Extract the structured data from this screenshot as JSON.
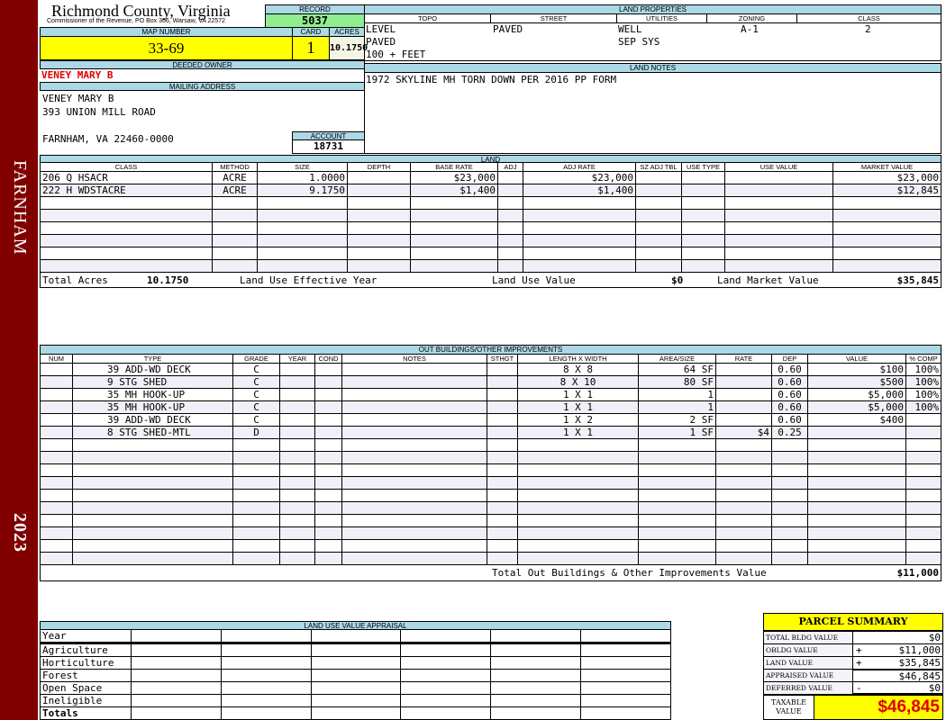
{
  "sidebar": {
    "locality": "FARNHAM",
    "year": "2023"
  },
  "header": {
    "county": "Richmond County, Virginia",
    "subtitle": "Commissioner of the Revenue, PO Box 366, Warsaw, VA 22572",
    "record_label": "RECORD",
    "record": "5037",
    "map_number_label": "MAP NUMBER",
    "map_number": "33-69",
    "card_label": "CARD",
    "card": "1",
    "acres_label": "ACRES",
    "acres": "10.1750"
  },
  "owner": {
    "deeded_owner_label": "DEEDED OWNER",
    "deeded_owner": "VENEY MARY B",
    "mailing_label": "MAILING ADDRESS",
    "lines": [
      "VENEY MARY B",
      "393 UNION MILL ROAD",
      "",
      "FARNHAM, VA 22460-0000"
    ],
    "account_label": "ACCOUNT",
    "account": "18731"
  },
  "land_properties": {
    "title": "LAND PROPERTIES",
    "headers": [
      "TOPO",
      "STREET",
      "UTILITIES",
      "ZONING",
      "CLASS"
    ],
    "topo": [
      "LEVEL",
      "PAVED",
      "100 + FEET"
    ],
    "street": "PAVED",
    "utilities": [
      "WELL",
      "SEP SYS"
    ],
    "zoning": "A-1",
    "class": "2"
  },
  "land_notes": {
    "title": "LAND NOTES",
    "text": "1972 SKYLINE MH TORN DOWN PER 2016 PP FORM"
  },
  "land": {
    "title": "LAND",
    "headers": [
      "CLASS",
      "METHOD",
      "SIZE",
      "DEPTH",
      "BASE RATE",
      "ADJ",
      "ADJ RATE",
      "SZ ADJ TBL",
      "USE TYPE",
      "USE VALUE",
      "MARKET VALUE"
    ],
    "rows": [
      [
        "206 Q HSACR",
        "ACRE",
        "1.0000",
        "",
        "$23,000",
        "",
        "$23,000",
        "",
        "",
        "",
        "$23,000"
      ],
      [
        "222 H WDSTACRE",
        "ACRE",
        "9.1750",
        "",
        "$1,400",
        "",
        "$1,400",
        "",
        "",
        "",
        "$12,845"
      ]
    ],
    "total_acres_label": "Total Acres",
    "total_acres": "10.1750",
    "effective_year_label": "Land Use Effective Year",
    "use_value_label": "Land Use Value",
    "use_value": "$0",
    "market_value_label": "Land Market Value",
    "market_value": "$35,845"
  },
  "outbuildings": {
    "title": "OUT BUILDINGS/OTHER IMPROVEMENTS",
    "headers": [
      "NUM",
      "TYPE",
      "GRADE",
      "YEAR",
      "COND",
      "NOTES",
      "STHGT",
      "LENGTH X WIDTH",
      "AREA/SIZE",
      "RATE",
      "DEP",
      "VALUE",
      "% COMP"
    ],
    "rows": [
      [
        "",
        "39 ADD-WD DECK",
        "C",
        "",
        "",
        "",
        "",
        "8 X 8",
        "64 SF",
        "",
        "0.60",
        "$100",
        "100%"
      ],
      [
        "",
        "9 STG SHED",
        "C",
        "",
        "",
        "",
        "",
        "8 X 10",
        "80 SF",
        "",
        "0.60",
        "$500",
        "100%"
      ],
      [
        "",
        "35 MH HOOK-UP",
        "C",
        "",
        "",
        "",
        "",
        "1 X 1",
        "1",
        "",
        "0.60",
        "$5,000",
        "100%"
      ],
      [
        "",
        "35 MH HOOK-UP",
        "C",
        "",
        "",
        "",
        "",
        "1 X 1",
        "1",
        "",
        "0.60",
        "$5,000",
        "100%"
      ],
      [
        "",
        "39 ADD-WD DECK",
        "C",
        "",
        "",
        "",
        "",
        "1 X 2",
        "2 SF",
        "",
        "0.60",
        "$400",
        ""
      ],
      [
        "",
        "8 STG SHED-MTL",
        "D",
        "",
        "",
        "",
        "",
        "1 X 1",
        "1 SF",
        "$4",
        "0.25",
        "",
        ""
      ]
    ],
    "total_label": "Total Out Buildings & Other Improvements Value",
    "total": "$11,000"
  },
  "land_use_appraisal": {
    "title": "LAND USE VALUE APPRAISAL",
    "rows": [
      "Year",
      "Agriculture",
      "Horticulture",
      "Forest",
      "Open Space",
      "Ineligible",
      "Totals"
    ]
  },
  "parcel_summary": {
    "title": "PARCEL SUMMARY",
    "rows": [
      {
        "label": "TOTAL BLDG VALUE",
        "sign": "",
        "value": "$0"
      },
      {
        "label": "OBLDG VALUE",
        "sign": "+",
        "value": "$11,000"
      },
      {
        "label": "LAND VALUE",
        "sign": "+",
        "value": "$35,845"
      },
      {
        "label": "APPRAISED VALUE",
        "sign": "",
        "value": "$46,845"
      },
      {
        "label": "DEFERRED VALUE",
        "sign": "-",
        "value": "$0"
      }
    ],
    "taxable_label": "TAXABLE VALUE",
    "taxable": "$46,845"
  }
}
